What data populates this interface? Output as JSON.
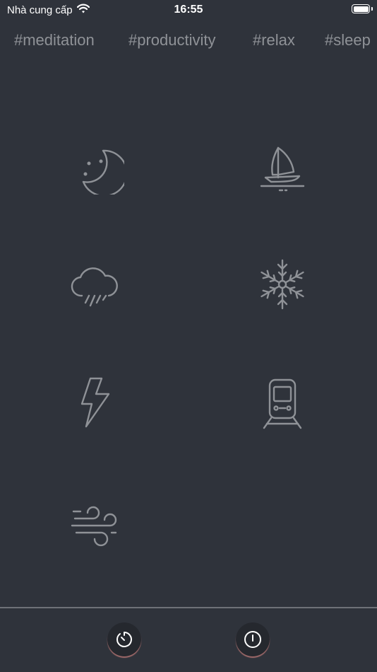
{
  "status_bar": {
    "carrier": "Nhà cung cấp",
    "time": "16:55",
    "wifi_icon": "wifi-icon",
    "battery_icon": "battery-icon"
  },
  "tags": [
    "#meditation",
    "#productivity",
    "#relax",
    "#sleep"
  ],
  "sounds": [
    {
      "icon": "moon-stars-icon"
    },
    {
      "icon": "sailboat-icon"
    },
    {
      "icon": "rain-cloud-icon"
    },
    {
      "icon": "snowflake-icon"
    },
    {
      "icon": "lightning-icon"
    },
    {
      "icon": "train-icon"
    },
    {
      "icon": "wind-icon"
    }
  ],
  "bottom_bar": {
    "timer_icon": "timer-icon",
    "power_icon": "power-icon"
  },
  "colors": {
    "background": "#2f333b",
    "icon_stroke": "#8f9297",
    "tag_text": "#8f9297",
    "button_bg": "#25282e",
    "button_accent": "#a06a6a"
  }
}
